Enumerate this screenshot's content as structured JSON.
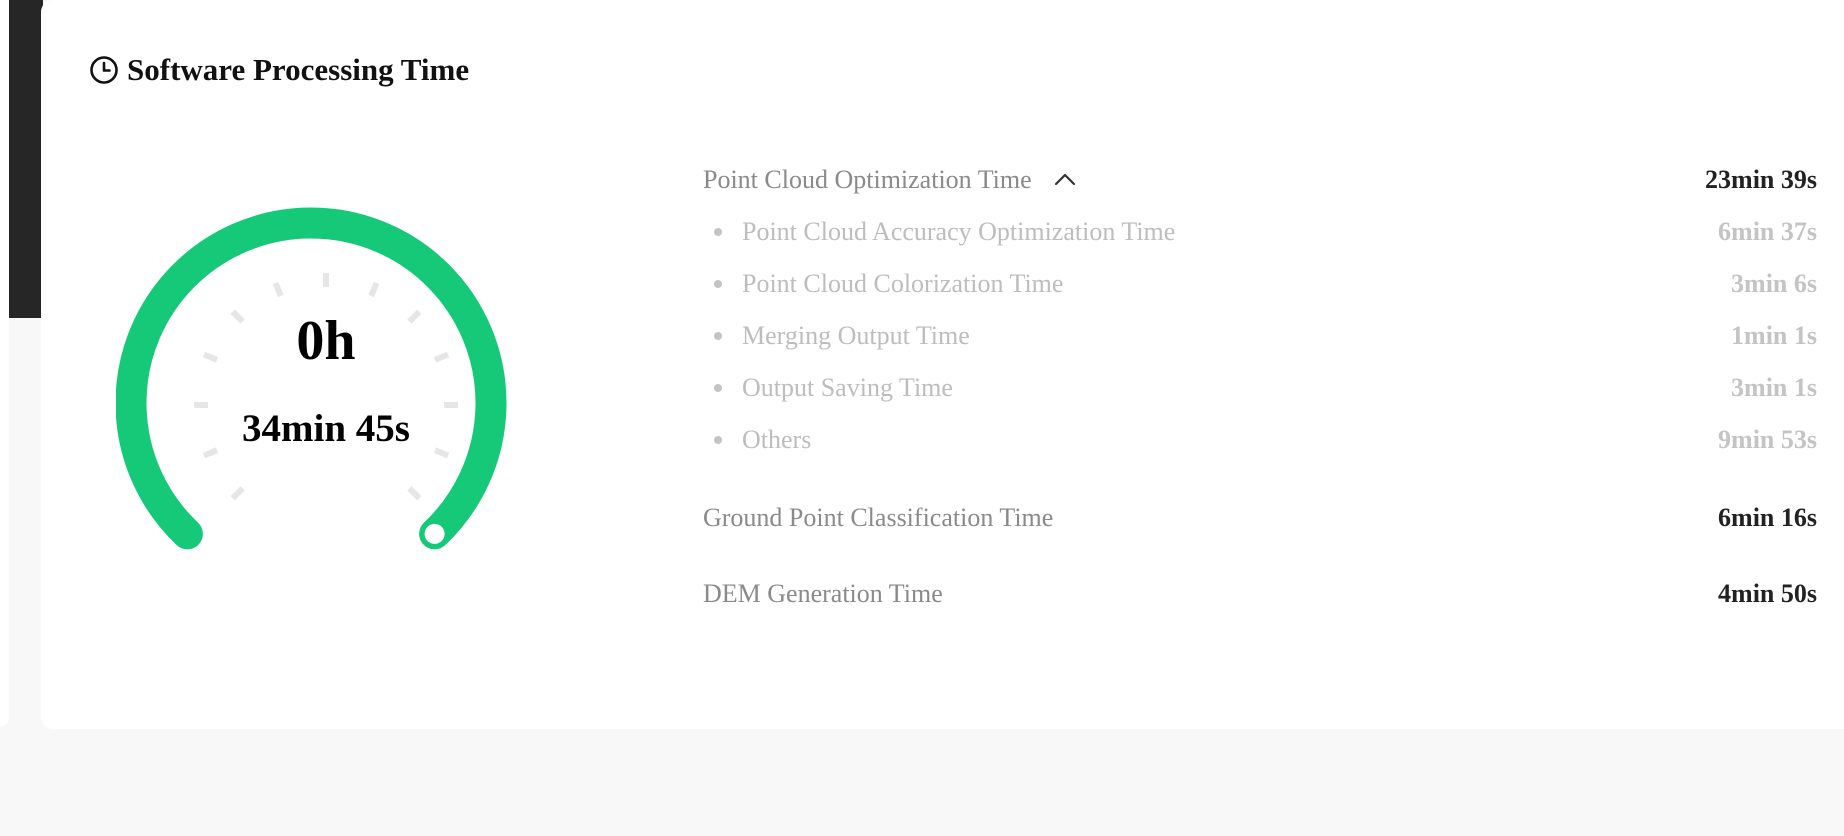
{
  "card": {
    "title": "Software Processing Time",
    "title_icon": "clock-icon"
  },
  "gauge": {
    "hours": "0h",
    "minutes": "34min 45s",
    "accent_color": "#16c978"
  },
  "groups": [
    {
      "label": "Point Cloud Optimization Time",
      "value": "23min 39s",
      "expanded": true,
      "toggle_icon": "chevron-up-icon",
      "children": [
        {
          "label": "Point Cloud Accuracy Optimization Time",
          "value": "6min 37s"
        },
        {
          "label": "Point Cloud Colorization Time",
          "value": "3min 6s"
        },
        {
          "label": "Merging Output Time",
          "value": "1min 1s"
        },
        {
          "label": "Output Saving Time",
          "value": "3min 1s"
        },
        {
          "label": "Others",
          "value": "9min 53s"
        }
      ]
    },
    {
      "label": "Ground Point Classification Time",
      "value": "6min 16s"
    },
    {
      "label": "DEM Generation Time",
      "value": "4min 50s"
    }
  ]
}
